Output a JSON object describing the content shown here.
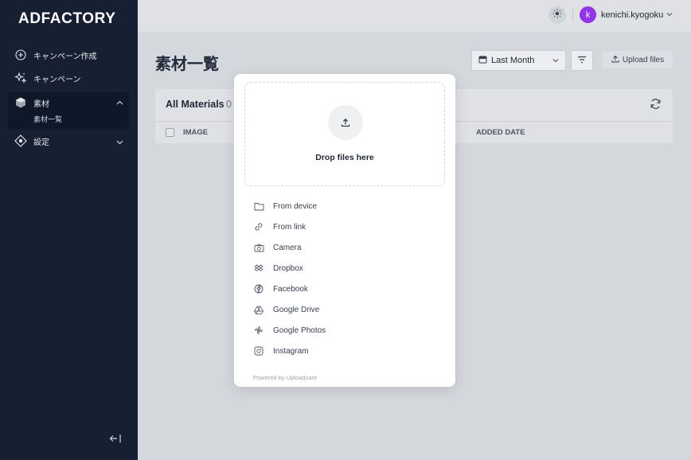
{
  "sidebar": {
    "logo": "ADFACTORY",
    "items": [
      {
        "label": "キャンペーン作成",
        "icon": "plus-circle-icon"
      },
      {
        "label": "キャンペーン",
        "icon": "sparkles-icon"
      },
      {
        "label": "素材",
        "icon": "cube-icon",
        "sub": "素材一覧"
      },
      {
        "label": "設定",
        "icon": "settings-icon"
      }
    ],
    "collapse_icon": "←|"
  },
  "topbar": {
    "username": "kenichi.kyogoku",
    "avatar_letter": "k",
    "avatar_color": "#9333ea"
  },
  "main": {
    "title": "素材一覧",
    "date_filter": "Last Month",
    "upload_label": "Upload files",
    "card": {
      "title": "All Materials",
      "count": "0",
      "columns": [
        "IMAGE",
        "ADDED DATE"
      ]
    }
  },
  "uploader": {
    "drop_text": "Drop files here",
    "sources": [
      {
        "label": "From device",
        "icon": "folder-icon"
      },
      {
        "label": "From link",
        "icon": "link-icon"
      },
      {
        "label": "Camera",
        "icon": "camera-icon"
      },
      {
        "label": "Dropbox",
        "icon": "dropbox-icon"
      },
      {
        "label": "Facebook",
        "icon": "facebook-icon"
      },
      {
        "label": "Google Drive",
        "icon": "google-drive-icon"
      },
      {
        "label": "Google Photos",
        "icon": "google-photos-icon"
      },
      {
        "label": "Instagram",
        "icon": "instagram-icon"
      }
    ],
    "powered_by": "Powered by Uploadcare"
  }
}
